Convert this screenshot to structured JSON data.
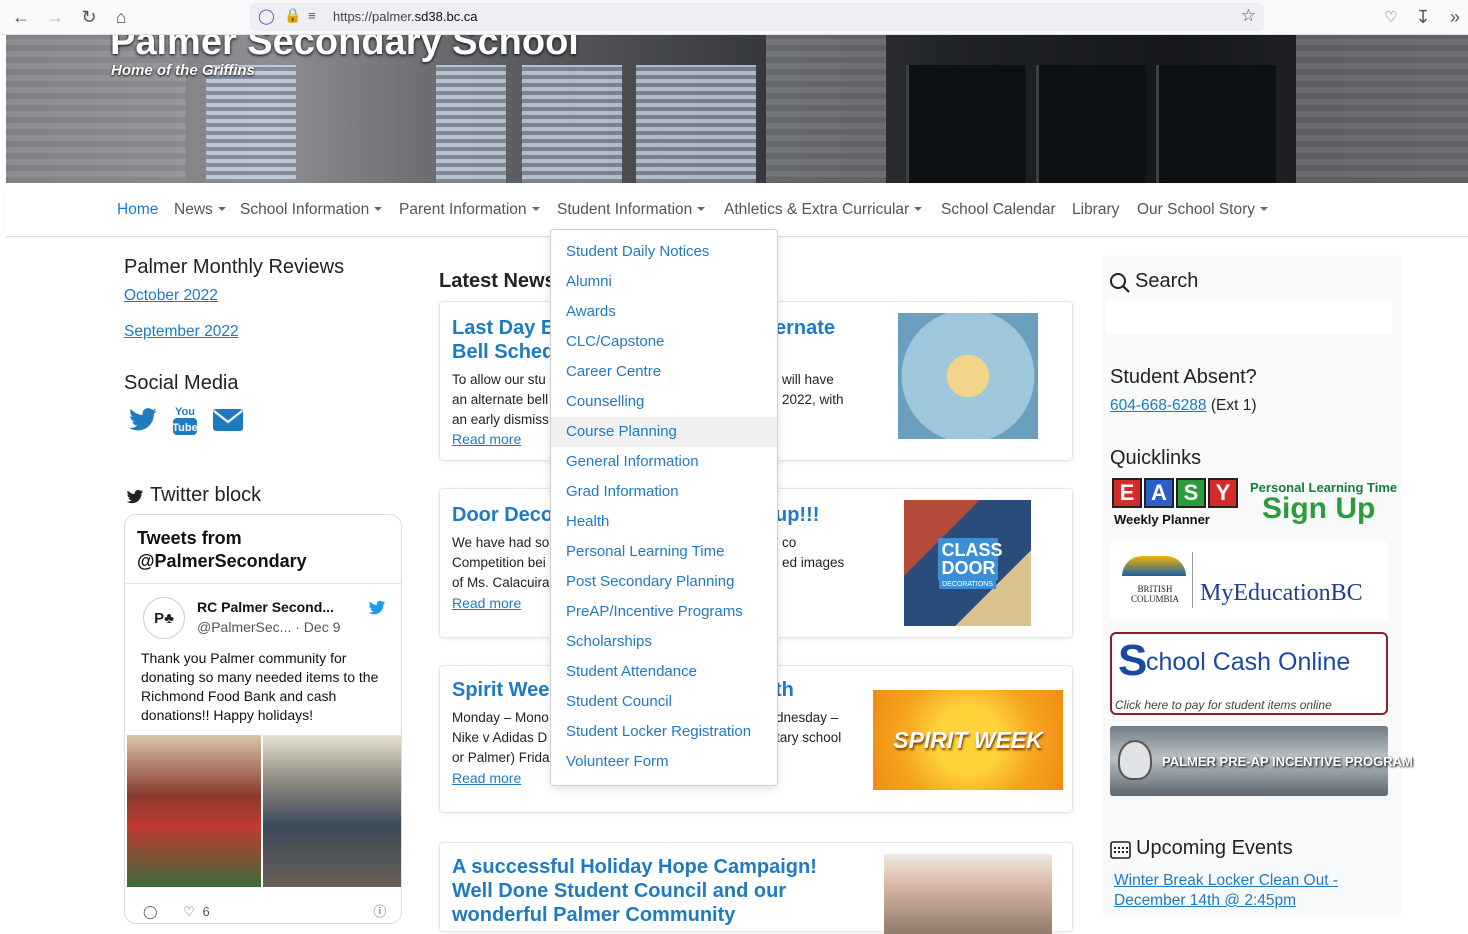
{
  "browser": {
    "url_prefix": "https://palmer.",
    "url_domain": "sd38.bc.ca"
  },
  "hero": {
    "title": "Palmer Secondary School",
    "tagline": "Home of the Griffins"
  },
  "nav": {
    "items": [
      {
        "label": "Home",
        "dropdown": false
      },
      {
        "label": "News",
        "dropdown": true
      },
      {
        "label": "School Information",
        "dropdown": true
      },
      {
        "label": "Parent Information",
        "dropdown": true
      },
      {
        "label": "Student Information",
        "dropdown": true
      },
      {
        "label": "Athletics & Extra Curricular",
        "dropdown": true
      },
      {
        "label": "School Calendar",
        "dropdown": false
      },
      {
        "label": "Library",
        "dropdown": false
      },
      {
        "label": "Our School Story",
        "dropdown": true
      }
    ]
  },
  "dropdown": {
    "items": [
      "Student Daily Notices",
      "Alumni",
      "Awards",
      "CLC/Capstone",
      "Career Centre",
      "Counselling",
      "Course Planning",
      "General Information",
      "Grad Information",
      "Health",
      "Personal Learning Time",
      "Post Secondary Planning",
      "PreAP/Incentive Programs",
      "Scholarships",
      "Student Attendance",
      "Student Council",
      "Student Locker Registration",
      "Volunteer Form"
    ],
    "hovered": "Course Planning"
  },
  "left": {
    "reviews_heading": "Palmer Monthly Reviews",
    "reviews": [
      "October 2022",
      "September 2022"
    ],
    "social_heading": "Social Media",
    "twitter_heading": "Twitter block",
    "tweets_heading": "Tweets from @PalmerSecondary",
    "tweet": {
      "name": "RC Palmer Second...",
      "handle": "@PalmerSec...",
      "date": "· Dec 9",
      "text": "Thank you Palmer community for donating so many needed items to the Richmond Food Bank and cash donations!! Happy holidays!",
      "likes": "6"
    }
  },
  "news": {
    "heading": "Latest News",
    "read_more": "Read more",
    "cards": [
      {
        "title_l1": "Last Day B",
        "title_l1b": "ernate",
        "title_l2": "Bell Sched",
        "body": [
          "To allow our stu",
          "an alternate bell",
          "an early dismiss"
        ],
        "body_r": [
          "will have",
          "2022, with",
          ""
        ]
      },
      {
        "title_l1": "Door Deco",
        "title_l1b": "up!!!",
        "body": [
          "We have had so",
          "Competition bei",
          "of Ms. Calacuira"
        ],
        "body_r": [
          "co",
          "ed images",
          ""
        ]
      },
      {
        "title_l1": "Spirit Weel",
        "title_l1b": "th",
        "body": [
          "Monday – Mono",
          "Nike v Adidas D",
          "or Palmer) Frida"
        ],
        "body_r": [
          "dnesday –",
          "tary school",
          ""
        ]
      },
      {
        "title_l1": "A successful Holiday Hope Campaign!",
        "title_l2": "Well Done Student Council and our",
        "title_l3": "wonderful Palmer Community"
      }
    ],
    "thumb_labels": {
      "door": "CLASS DOOR",
      "door_sub": "DECORATIONS",
      "spirit": "SPIRIT WEEK"
    }
  },
  "right": {
    "search_label": "Search",
    "absent_heading": "Student Absent?",
    "absent_phone": "604-668-6288",
    "absent_ext": "(Ext 1)",
    "quicklinks_heading": "Quicklinks",
    "ql_easy": "EASY",
    "ql_weekly": "Weekly Planner",
    "ql_plt": "Personal Learning Time",
    "ql_signup": "Sign Up",
    "ql_bc": "BRITISH COLUMBIA",
    "ql_myed": "MyEducationBC",
    "ql_cash": "chool Cash Online",
    "ql_cash_s": "S",
    "ql_cash_sub": "Click here to pay for student items online",
    "ql_preap": "PALMER PRE-AP INCENTIVE PROGRAM",
    "events_heading": "Upcoming Events",
    "events": [
      "Winter Break Locker Clean Out -",
      "December 14th @ 2:45pm"
    ]
  },
  "colors": {
    "link": "#1f7bc1",
    "twitter": "#1d9bf0"
  }
}
